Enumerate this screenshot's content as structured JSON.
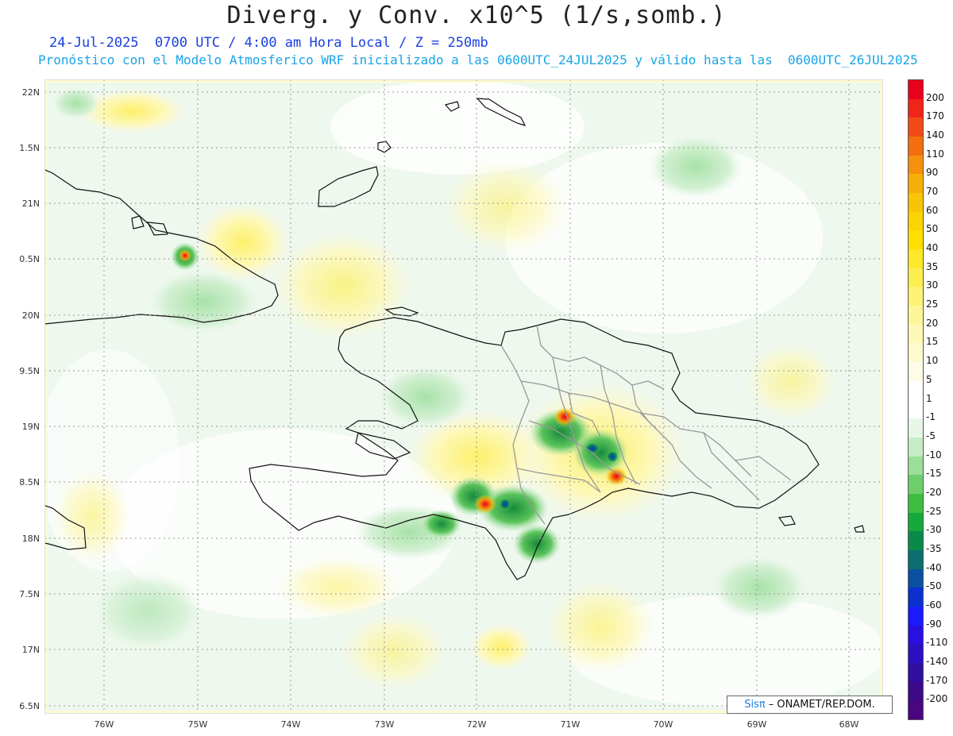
{
  "header": {
    "title": "Diverg. y Conv. x10^5 (1/s,somb.)",
    "subtitle_valid": "24-Jul-2025  0700 UTC / 4:00 am Hora Local / Z = 250mb",
    "subtitle_model": "Pronóstico con el Modelo Atmosferico WRF inicializado a las 0600UTC_24JUL2025 y válido hasta las  0600UTC_26JUL2025"
  },
  "map": {
    "lat_labels": [
      "22N",
      "1.5N",
      "21N",
      "0.5N",
      "20N",
      "9.5N",
      "19N",
      "8.5N",
      "18N",
      "7.5N",
      "17N",
      "6.5N"
    ],
    "lon_labels": [
      "76W",
      "75W",
      "74W",
      "73W",
      "72W",
      "71W",
      "70W",
      "69W",
      "68W"
    ],
    "grid": true
  },
  "colorbar": {
    "labels": [
      "200",
      "170",
      "140",
      "110",
      "90",
      "70",
      "60",
      "50",
      "40",
      "35",
      "30",
      "25",
      "20",
      "15",
      "10",
      "5",
      "1",
      "-1",
      "-5",
      "-10",
      "-15",
      "-20",
      "-25",
      "-30",
      "-35",
      "-40",
      "-50",
      "-60",
      "-90",
      "-110",
      "-140",
      "-170",
      "-200"
    ],
    "colors": [
      "#e8001c",
      "#f02418",
      "#f24a14",
      "#f46e10",
      "#f6900c",
      "#f8ae08",
      "#fac406",
      "#fcd404",
      "#fde000",
      "#fde82a",
      "#fdee50",
      "#fdf274",
      "#fdf698",
      "#fdf8b6",
      "#fefad0",
      "#fefce6",
      "#ffffff",
      "#ffffff",
      "#e8f6e8",
      "#c6ecc6",
      "#9ade9a",
      "#6ccf6c",
      "#3ebe3e",
      "#16a83a",
      "#0a8a4a",
      "#0a6e6e",
      "#0a50a0",
      "#0a30d0",
      "#1a1aff",
      "#2a10e0",
      "#2a10c0",
      "#300ea0",
      "#3c0a88",
      "#4a0680"
    ]
  },
  "credit": {
    "brand": "Sisπ",
    "text": "– ONAMET/REP.DOM."
  }
}
